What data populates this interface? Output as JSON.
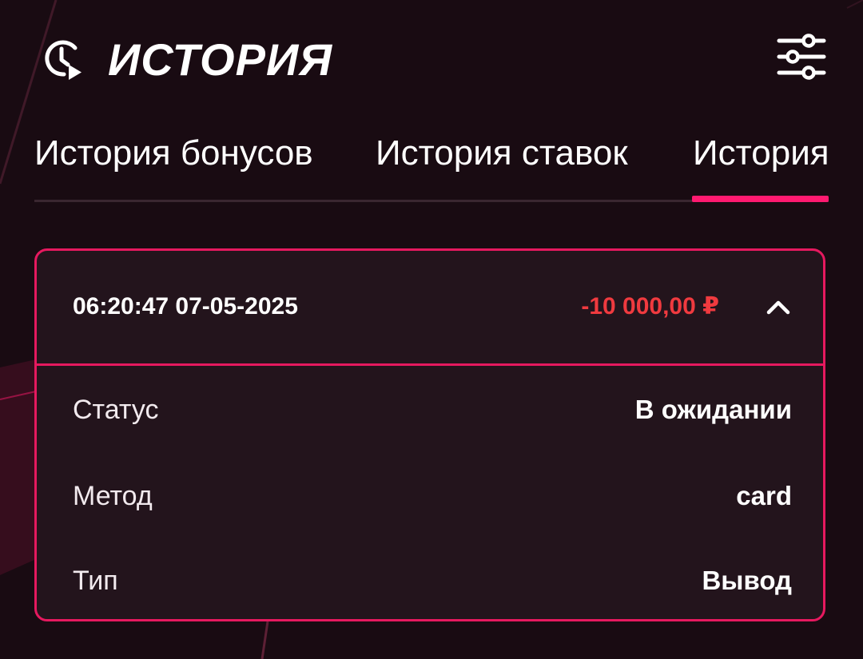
{
  "header": {
    "title": "ИСТОРИЯ"
  },
  "tabs": [
    {
      "label": "История бонусов"
    },
    {
      "label": "История ставок"
    },
    {
      "label": "История"
    }
  ],
  "active_tab_index": 2,
  "transaction": {
    "datetime": "06:20:47 07-05-2025",
    "amount": "-10 000,00 ₽",
    "expanded": true,
    "details": [
      {
        "label": "Статус",
        "value": "В ожидании"
      },
      {
        "label": "Метод",
        "value": "card"
      },
      {
        "label": "Тип",
        "value": "Вывод"
      }
    ]
  },
  "colors": {
    "background": "#190b12",
    "card_background": "#23141c",
    "accent": "#ff1a70",
    "card_border": "#e6195f",
    "negative_amount": "#f03a3f",
    "text": "#ffffff"
  },
  "icons": {
    "header": "history-clock-play-icon",
    "filter": "sliders-icon",
    "expand": "chevron-up-icon"
  }
}
